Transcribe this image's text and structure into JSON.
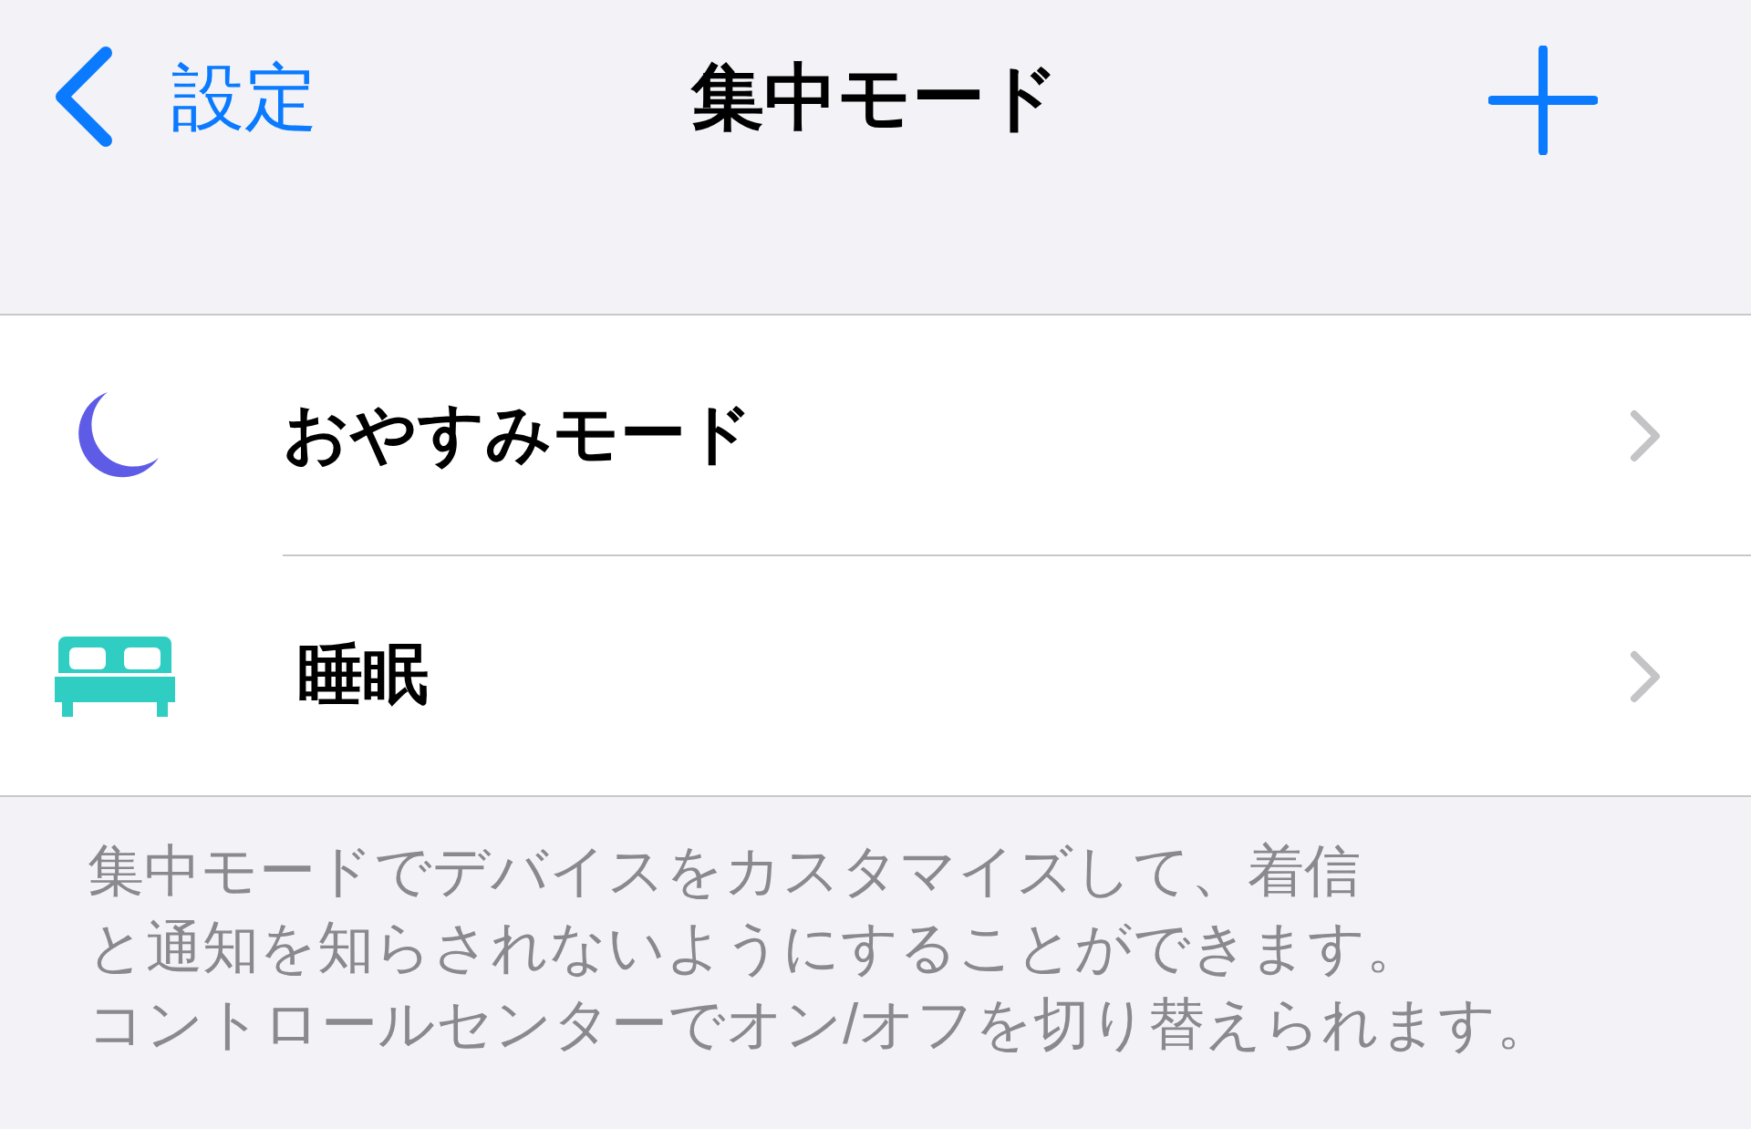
{
  "nav": {
    "back": "設定",
    "title": "集中モード"
  },
  "modes": [
    {
      "kind": "moon",
      "label": "おやすみモード"
    },
    {
      "kind": "bed",
      "label": "睡眠"
    }
  ],
  "footer_lines": [
    "集中モードでデバイスをカスタマイズして、着信",
    "と通知を知らされないようにすることができます。",
    "コントロールセンターでオン/オフを切り替えられます。"
  ]
}
